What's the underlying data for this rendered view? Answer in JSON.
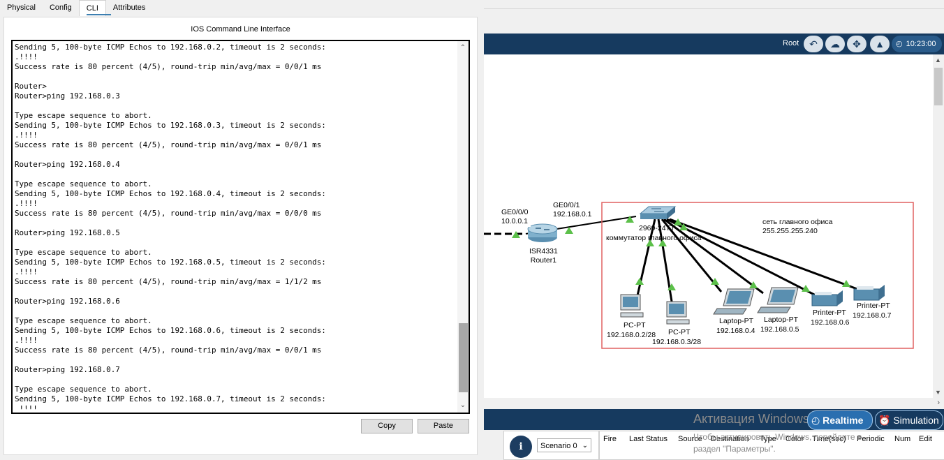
{
  "tabs": [
    "Physical",
    "Config",
    "CLI",
    "Attributes"
  ],
  "cli": {
    "title": "IOS Command Line Interface",
    "lines": [
      "Sending 5, 100-byte ICMP Echos to 192.168.0.2, timeout is 2 seconds:",
      ".!!!!",
      "Success rate is 80 percent (4/5), round-trip min/avg/max = 0/0/1 ms",
      "",
      "Router>",
      "Router>ping 192.168.0.3",
      "",
      "Type escape sequence to abort.",
      "Sending 5, 100-byte ICMP Echos to 192.168.0.3, timeout is 2 seconds:",
      ".!!!!",
      "Success rate is 80 percent (4/5), round-trip min/avg/max = 0/0/1 ms",
      "",
      "Router>ping 192.168.0.4",
      "",
      "Type escape sequence to abort.",
      "Sending 5, 100-byte ICMP Echos to 192.168.0.4, timeout is 2 seconds:",
      ".!!!!",
      "Success rate is 80 percent (4/5), round-trip min/avg/max = 0/0/0 ms",
      "",
      "Router>ping 192.168.0.5",
      "",
      "Type escape sequence to abort.",
      "Sending 5, 100-byte ICMP Echos to 192.168.0.5, timeout is 2 seconds:",
      ".!!!!",
      "Success rate is 80 percent (4/5), round-trip min/avg/max = 1/1/2 ms",
      "",
      "Router>ping 192.168.0.6",
      "",
      "Type escape sequence to abort.",
      "Sending 5, 100-byte ICMP Echos to 192.168.0.6, timeout is 2 seconds:",
      ".!!!!",
      "Success rate is 80 percent (4/5), round-trip min/avg/max = 0/0/1 ms",
      "",
      "Router>ping 192.168.0.7",
      "",
      "Type escape sequence to abort.",
      "Sending 5, 100-byte ICMP Echos to 192.168.0.7, timeout is 2 seconds:",
      ".!!!!"
    ],
    "copy_label": "Copy",
    "paste_label": "Paste"
  },
  "toolbar": {
    "root_label": "Root",
    "time": "10:23:00"
  },
  "topology": {
    "router_if_left": {
      "name": "GE0/0/0",
      "ip": "10.0.0.1"
    },
    "router_if_right": {
      "name": "GE0/0/1",
      "ip": "192.168.0.1"
    },
    "router": {
      "model": "ISR4331",
      "name": "Router1"
    },
    "switch": {
      "model": "2960-24TT",
      "name": "коммутатор главного офиса"
    },
    "note": {
      "line1": "сеть главного офиса",
      "line2": "255.255.255.240"
    },
    "devices": [
      {
        "type": "PC-PT",
        "ip": "192.168.0.2/28"
      },
      {
        "type": "PC-PT",
        "ip": "192.168.0.3/28"
      },
      {
        "type": "Laptop-PT",
        "ip": "192.168.0.4"
      },
      {
        "type": "Laptop-PT",
        "ip": "192.168.0.5"
      },
      {
        "type": "Printer-PT",
        "ip": "192.168.0.6"
      },
      {
        "type": "Printer-PT",
        "ip": "192.168.0.7"
      }
    ]
  },
  "bottom": {
    "scenario": "Scenario 0",
    "realtime_label": "Realtime",
    "simulation_label": "Simulation",
    "columns": [
      "Fire",
      "Last Status",
      "Source",
      "Destination",
      "Type",
      "Color",
      "Time(sec)",
      "Periodic",
      "Num",
      "Edit"
    ],
    "activation_title": "Активация Windows",
    "activation_line1": "Чтобы активировать Windows, перейдите в",
    "activation_line2": "раздел \"Параметры\"."
  },
  "colors": {
    "nav": "#163a5f",
    "link_up": "#5cc04a",
    "note_border": "#e06060"
  }
}
